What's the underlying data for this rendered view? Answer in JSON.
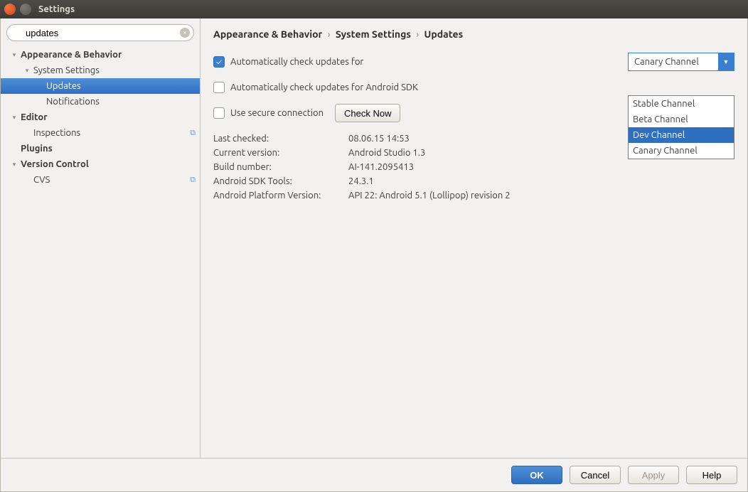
{
  "window": {
    "title": "Settings"
  },
  "search": {
    "value": "updates"
  },
  "sidebar": {
    "items": [
      {
        "label": "Appearance & Behavior",
        "level": 0,
        "bold": true,
        "disclosure": "▾"
      },
      {
        "label": "System Settings",
        "level": 1,
        "bold": false,
        "disclosure": "▾"
      },
      {
        "label": "Updates",
        "level": 2,
        "bold": false,
        "selected": true
      },
      {
        "label": "Notifications",
        "level": 2,
        "bold": false
      },
      {
        "label": "Editor",
        "level": 0,
        "bold": true,
        "disclosure": "▾"
      },
      {
        "label": "Inspections",
        "level": 1,
        "bold": false,
        "rightIcon": true
      },
      {
        "label": "Plugins",
        "level": 0,
        "bold": true
      },
      {
        "label": "Version Control",
        "level": 0,
        "bold": true,
        "disclosure": "▾"
      },
      {
        "label": "CVS",
        "level": 1,
        "bold": false,
        "rightIcon": true
      }
    ]
  },
  "breadcrumb": {
    "a": "Appearance & Behavior",
    "b": "System Settings",
    "c": "Updates",
    "sep": "›"
  },
  "form": {
    "autoCheck": {
      "label": "Automatically check updates for",
      "checked": true
    },
    "autoCheckSdk": {
      "label": "Automatically check updates for Android SDK",
      "checked": false
    },
    "secure": {
      "label": "Use secure connection",
      "checked": false
    },
    "checkNow": "Check Now",
    "channel": {
      "selected": "Canary Channel",
      "options": [
        "Stable Channel",
        "Beta Channel",
        "Dev Channel",
        "Canary Channel"
      ],
      "highlighted": "Dev Channel"
    }
  },
  "info": {
    "rows": [
      {
        "k": "Last checked:",
        "v": "08.06.15 14:53"
      },
      {
        "k": "Current version:",
        "v": "Android Studio 1.3"
      },
      {
        "k": "Build number:",
        "v": "AI-141.2095413"
      },
      {
        "k": "Android SDK Tools:",
        "v": "24.3.1"
      },
      {
        "k": "Android Platform Version:",
        "v": "API 22: Android 5.1 (Lollipop) revision 2"
      }
    ]
  },
  "footer": {
    "ok": "OK",
    "cancel": "Cancel",
    "apply": "Apply",
    "help": "Help"
  }
}
